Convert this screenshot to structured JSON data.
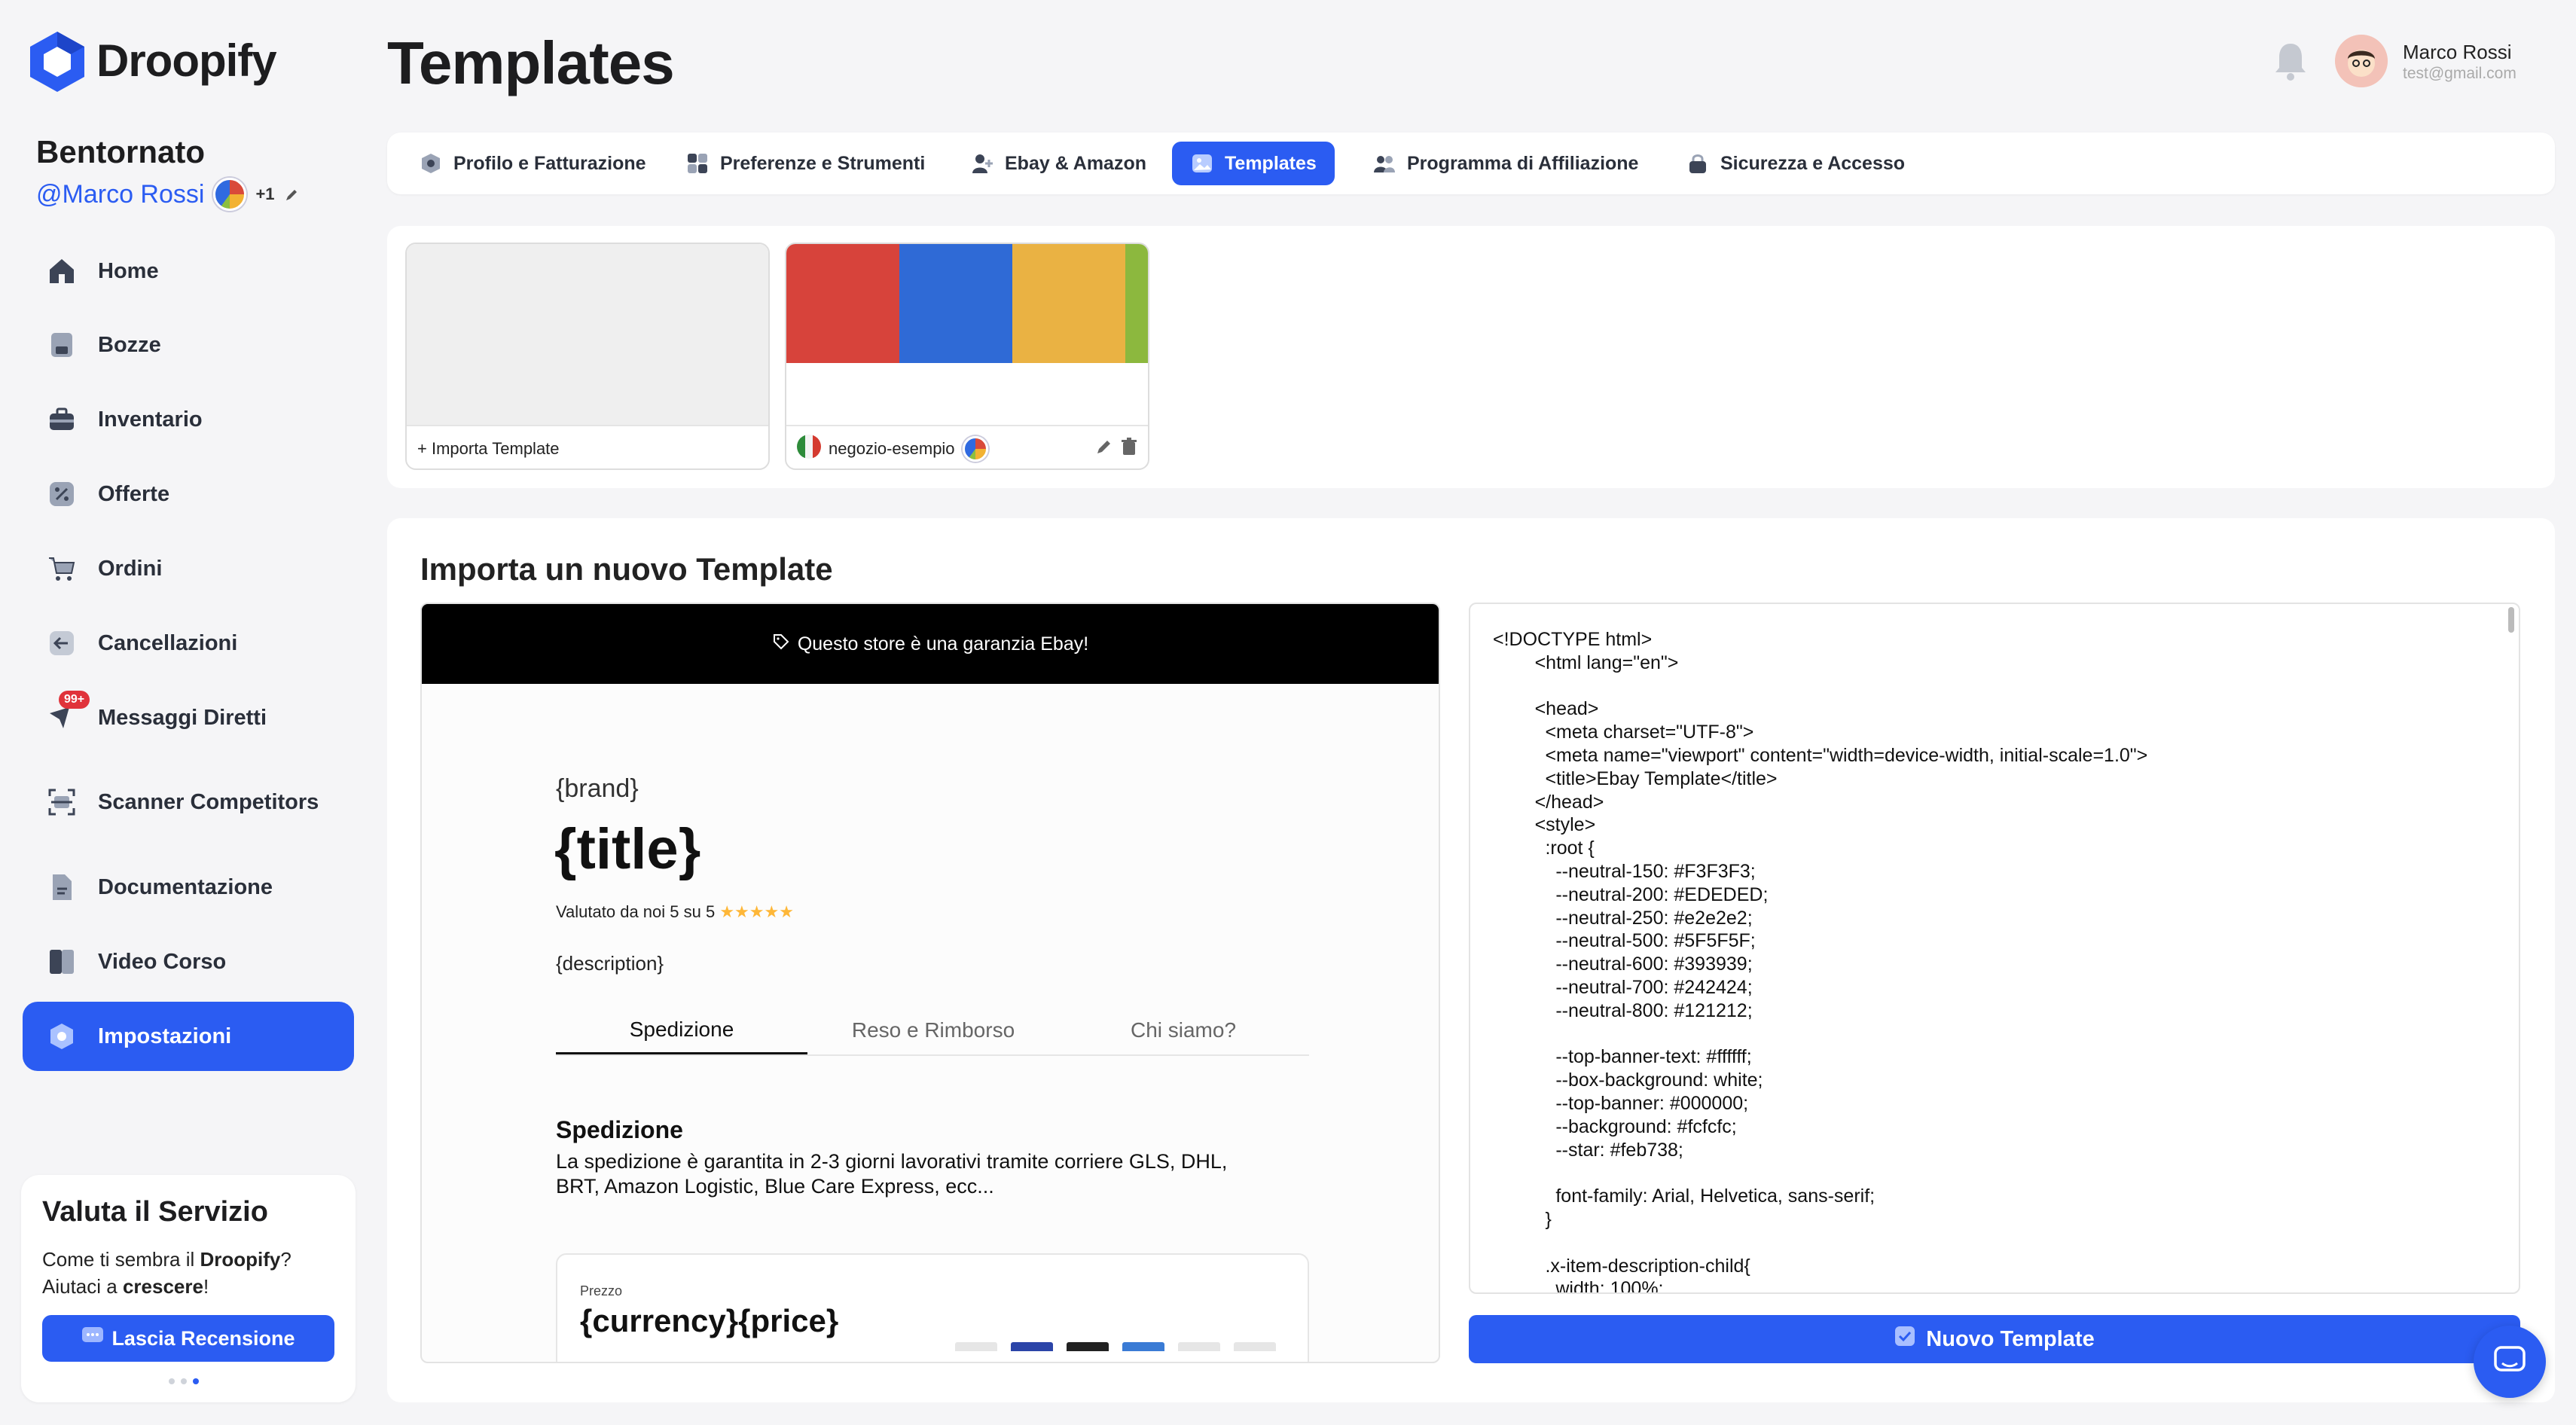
{
  "brand": {
    "name": "Droopify",
    "accent": "#2b5cf2"
  },
  "sidebar": {
    "greeting": "Bentornato",
    "user_handle": "@Marco Rossi",
    "extra_count": "+1",
    "items": [
      {
        "label": "Home",
        "icon": "home-icon"
      },
      {
        "label": "Bozze",
        "icon": "drafts-icon"
      },
      {
        "label": "Inventario",
        "icon": "briefcase-icon"
      },
      {
        "label": "Offerte",
        "icon": "discount-icon"
      },
      {
        "label": "Ordini",
        "icon": "cart-icon"
      },
      {
        "label": "Cancellazioni",
        "icon": "arrow-left-icon"
      },
      {
        "label": "Messaggi Diretti",
        "icon": "message-icon",
        "badge": "99+"
      },
      {
        "label": "Scanner Competitors",
        "icon": "scanner-icon"
      },
      {
        "label": "Documentazione",
        "icon": "document-icon"
      },
      {
        "label": "Video Corso",
        "icon": "book-icon"
      },
      {
        "label": "Impostazioni",
        "icon": "gear-icon",
        "active": true
      }
    ],
    "rate": {
      "title": "Valuta il Servizio",
      "line1_prefix": "Come ti sembra il ",
      "line1_brand": "Droopify",
      "line1_suffix": "?",
      "line2_prefix": "Aiutaci a ",
      "line2_bold": "crescere",
      "line2_suffix": "!",
      "button": "Lascia Recensione"
    }
  },
  "header": {
    "title": "Templates",
    "user_name": "Marco Rossi",
    "user_email": "test@gmail.com"
  },
  "tabs": [
    {
      "label": "Profilo e Fatturazione",
      "icon": "gear-icon"
    },
    {
      "label": "Preferenze e Strumenti",
      "icon": "tools-icon"
    },
    {
      "label": "Ebay & Amazon",
      "icon": "user-plus-icon"
    },
    {
      "label": "Templates",
      "icon": "image-icon",
      "active": true
    },
    {
      "label": "Programma di Affiliazione",
      "icon": "users-icon"
    },
    {
      "label": "Sicurezza e Accesso",
      "icon": "lock-icon"
    }
  ],
  "template_cards": {
    "import_label": "+ Importa Template",
    "store_name": "negozio-esempio",
    "stripe_colors": [
      "#d7433b",
      "#2f6ad6",
      "#eab243",
      "#8cb83e"
    ]
  },
  "import_section": {
    "title": "Importa un nuovo Template",
    "preview": {
      "banner": "Questo store è una garanzia Ebay!",
      "brand": "{brand}",
      "title": "{title}",
      "rating": "Valutato da noi 5 su 5",
      "stars": "★★★★★",
      "description": "{description}",
      "tabs": [
        "Spedizione",
        "Reso e Rimborso",
        "Chi siamo?"
      ],
      "section_title": "Spedizione",
      "section_text_1": "La spedizione è garantita in 2-3 giorni lavorativi tramite corriere GLS, DHL,",
      "section_text_2": "BRT, Amazon Logistic, Blue Care Express, ecc...",
      "price_label": "Prezzo",
      "price": "{currency}{price}"
    },
    "code": "<!DOCTYPE html>\n        <html lang=\"en\">\n\n        <head>\n          <meta charset=\"UTF-8\">\n          <meta name=\"viewport\" content=\"width=device-width, initial-scale=1.0\">\n          <title>Ebay Template</title>\n        </head>\n        <style>\n          :root {\n            --neutral-150: #F3F3F3;\n            --neutral-200: #EDEDED;\n            --neutral-250: #e2e2e2;\n            --neutral-500: #5F5F5F;\n            --neutral-600: #393939;\n            --neutral-700: #242424;\n            --neutral-800: #121212;\n\n            --top-banner-text: #ffffff;\n            --box-background: white;\n            --top-banner: #000000;\n            --background: #fcfcfc;\n            --star: #feb738;\n\n            font-family: Arial, Helvetica, sans-serif;\n          }\n\n          .x-item-description-child{\n            width: 100%;",
    "new_button": "Nuovo Template"
  }
}
